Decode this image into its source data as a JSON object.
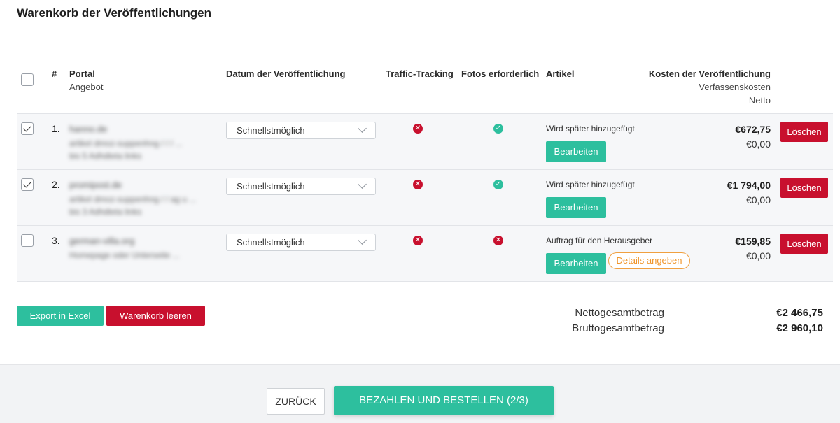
{
  "header": {
    "title": "Warenkorb der Veröffentlichungen"
  },
  "table": {
    "columns": {
      "index": "#",
      "portal": "Portal",
      "portal_sub": "Angebot",
      "date": "Datum der Veröffentlichung",
      "traffic": "Traffic-Tracking",
      "photos": "Fotos erforderlich",
      "article": "Artikel",
      "cost": "Kosten der Veröffentlichung",
      "cost_sub1": "Verfassenskosten",
      "cost_sub2": "Netto"
    },
    "rows": [
      {
        "num": "1.",
        "checked": true,
        "portal": "hanno.de",
        "offer_line1": "artikel dmoz-suppenhng / / / ...",
        "offer_line2": "bis 5 Adhdteta links",
        "date": "Schnellstmöglich",
        "traffic": "no",
        "photos": "yes",
        "article": "Wird später hinzugefügt",
        "edit": "Bearbeiten",
        "price": "€672,75",
        "price_sub": "€0,00",
        "delete": "Löschen"
      },
      {
        "num": "2.",
        "checked": true,
        "portal": "promipost.de",
        "offer_line1": "artikel dmoz-suppenhng / / ag u ...",
        "offer_line2": "bis 3 Adhdteta links",
        "date": "Schnellstmöglich",
        "traffic": "no",
        "photos": "yes",
        "article": "Wird später hinzugefügt",
        "edit": "Bearbeiten",
        "price": "€1 794,00",
        "price_sub": "€0,00",
        "delete": "Löschen"
      },
      {
        "num": "3.",
        "checked": false,
        "portal": "german-villa.org",
        "offer_line1": "Homepage oder Unterseite ...",
        "date": "Schnellstmöglich",
        "traffic": "no",
        "photos": "no",
        "article": "Auftrag für den Herausgeber",
        "edit": "Bearbeiten",
        "details": "Details angeben",
        "price": "€159,85",
        "price_sub": "€0,00",
        "delete": "Löschen"
      }
    ]
  },
  "actions": {
    "export": "Export in Excel",
    "clear": "Warenkorb leeren"
  },
  "totals": {
    "net_label": "Nettogesamtbetrag",
    "net_value": "€2 466,75",
    "gross_label": "Bruttogesamtbetrag",
    "gross_value": "€2 960,10"
  },
  "footer": {
    "back": "ZURÜCK",
    "pay": "BEZAHLEN UND BESTELLEN (2/3)"
  },
  "icons": {
    "no": "x-circle-icon",
    "yes": "check-circle-icon"
  },
  "colors": {
    "accent": "#2dbf9e",
    "danger": "#c8102e",
    "warning": "#f0952a"
  }
}
